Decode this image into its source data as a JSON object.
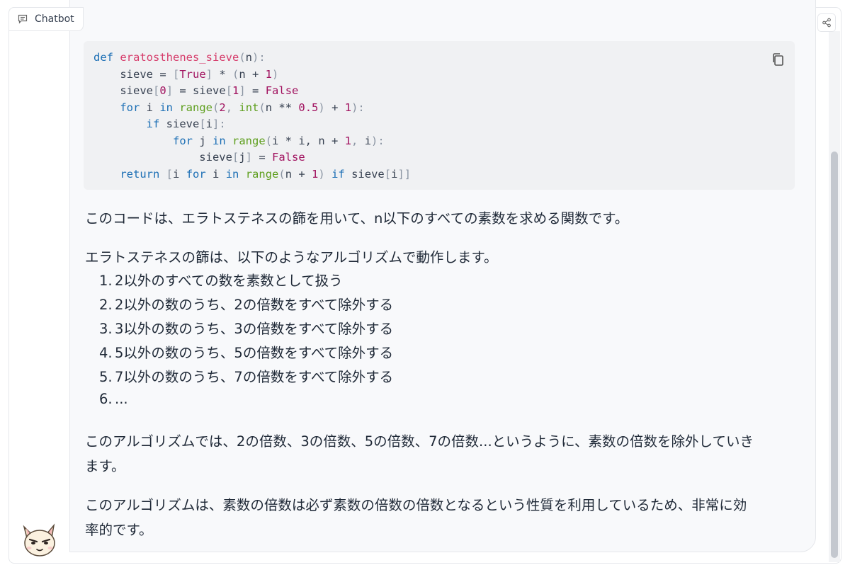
{
  "header": {
    "label": "Chatbot"
  },
  "code": {
    "lines": [
      [
        [
          "kw",
          "def "
        ],
        [
          "fn",
          "eratosthenes_sieve"
        ],
        [
          "punc",
          "("
        ],
        [
          "t",
          "n"
        ],
        [
          "punc",
          "):"
        ]
      ],
      [
        [
          "t",
          "    sieve = "
        ],
        [
          "punc",
          "["
        ],
        [
          "num",
          "True"
        ],
        [
          "punc",
          "]"
        ],
        [
          "t",
          " * "
        ],
        [
          "punc",
          "("
        ],
        [
          "t",
          "n + "
        ],
        [
          "num",
          "1"
        ],
        [
          "punc",
          ")"
        ]
      ],
      [
        [
          "t",
          "    sieve"
        ],
        [
          "punc",
          "["
        ],
        [
          "num",
          "0"
        ],
        [
          "punc",
          "]"
        ],
        [
          "t",
          " = sieve"
        ],
        [
          "punc",
          "["
        ],
        [
          "num",
          "1"
        ],
        [
          "punc",
          "]"
        ],
        [
          "t",
          " = "
        ],
        [
          "bool",
          "False"
        ]
      ],
      [
        [
          "t",
          "    "
        ],
        [
          "kw",
          "for"
        ],
        [
          "t",
          " i "
        ],
        [
          "kw",
          "in"
        ],
        [
          "t",
          " "
        ],
        [
          "bi",
          "range"
        ],
        [
          "punc",
          "("
        ],
        [
          "num",
          "2"
        ],
        [
          "punc",
          ", "
        ],
        [
          "bi",
          "int"
        ],
        [
          "punc",
          "("
        ],
        [
          "t",
          "n ** "
        ],
        [
          "num",
          "0.5"
        ],
        [
          "punc",
          ")"
        ],
        [
          "t",
          " + "
        ],
        [
          "num",
          "1"
        ],
        [
          "punc",
          "):"
        ]
      ],
      [
        [
          "t",
          "        "
        ],
        [
          "kw",
          "if"
        ],
        [
          "t",
          " sieve"
        ],
        [
          "punc",
          "["
        ],
        [
          "t",
          "i"
        ],
        [
          "punc",
          "]:"
        ]
      ],
      [
        [
          "t",
          "            "
        ],
        [
          "kw",
          "for"
        ],
        [
          "t",
          " j "
        ],
        [
          "kw",
          "in"
        ],
        [
          "t",
          " "
        ],
        [
          "bi",
          "range"
        ],
        [
          "punc",
          "("
        ],
        [
          "t",
          "i * i, n + "
        ],
        [
          "num",
          "1"
        ],
        [
          "punc",
          ", "
        ],
        [
          "t",
          "i"
        ],
        [
          "punc",
          "):"
        ]
      ],
      [
        [
          "t",
          "                sieve"
        ],
        [
          "punc",
          "["
        ],
        [
          "t",
          "j"
        ],
        [
          "punc",
          "]"
        ],
        [
          "t",
          " = "
        ],
        [
          "bool",
          "False"
        ]
      ],
      [
        [
          "t",
          "    "
        ],
        [
          "kw",
          "return"
        ],
        [
          "t",
          " "
        ],
        [
          "punc",
          "["
        ],
        [
          "t",
          "i "
        ],
        [
          "kw",
          "for"
        ],
        [
          "t",
          " i "
        ],
        [
          "kw",
          "in"
        ],
        [
          "t",
          " "
        ],
        [
          "bi",
          "range"
        ],
        [
          "punc",
          "("
        ],
        [
          "t",
          "n + "
        ],
        [
          "num",
          "1"
        ],
        [
          "punc",
          ")"
        ],
        [
          "t",
          " "
        ],
        [
          "kw",
          "if"
        ],
        [
          "t",
          " sieve"
        ],
        [
          "punc",
          "["
        ],
        [
          "t",
          "i"
        ],
        [
          "punc",
          "]]"
        ]
      ]
    ]
  },
  "message": {
    "p1": "このコードは、エラトステネスの篩を用いて、n以下のすべての素数を求める関数です。",
    "p2": "エラトステネスの篩は、以下のようなアルゴリズムで動作します。",
    "list": [
      {
        "n": "1.",
        "text": "2以外のすべての数を素数として扱う"
      },
      {
        "n": "2.",
        "text": "2以外の数のうち、2の倍数をすべて除外する"
      },
      {
        "n": "3.",
        "text": "3以外の数のうち、3の倍数をすべて除外する"
      },
      {
        "n": "4.",
        "text": "5以外の数のうち、5の倍数をすべて除外する"
      },
      {
        "n": "5.",
        "text": "7以外の数のうち、7の倍数をすべて除外する"
      },
      {
        "n": "6.",
        "text": "..."
      }
    ],
    "p3_line1": "このアルゴリズムでは、2の倍数、3の倍数、5の倍数、7の倍数...というように、素数の倍数を除外していき",
    "p3_line2": "ます。",
    "p4_line1": "このアルゴリズムは、素数の倍数は必ず素数の倍数の倍数となるという性質を利用しているため、非常に効",
    "p4_line2": "率的です。"
  }
}
